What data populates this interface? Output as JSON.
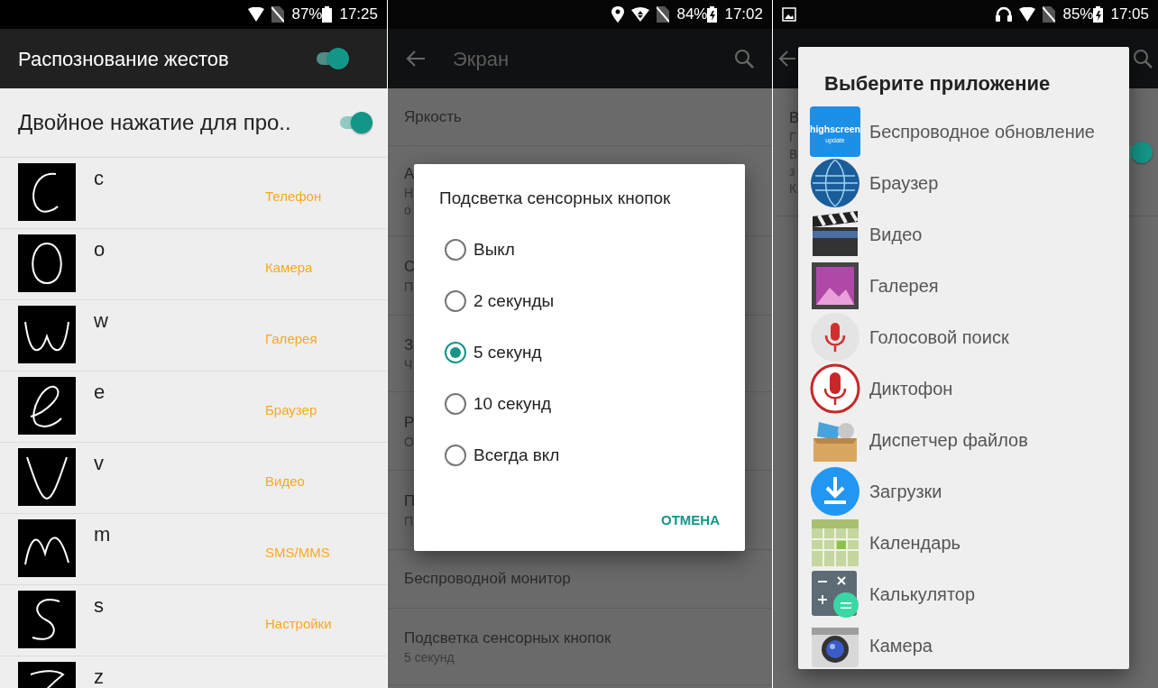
{
  "gesture_screen": {
    "status": {
      "battery": "87%",
      "charging": false,
      "time": "17:25"
    },
    "app_bar": {
      "title": "Распознование жестов",
      "on": true
    },
    "master": {
      "label": "Двойное нажатие для про..",
      "on": true
    },
    "gestures": [
      {
        "letter": "c",
        "app": "Телефон"
      },
      {
        "letter": "o",
        "app": "Камера"
      },
      {
        "letter": "w",
        "app": "Галерея"
      },
      {
        "letter": "e",
        "app": "Браузер"
      },
      {
        "letter": "v",
        "app": "Видео"
      },
      {
        "letter": "m",
        "app": "SMS/MMS"
      },
      {
        "letter": "s",
        "app": "Настройки"
      },
      {
        "letter": "z"
      }
    ]
  },
  "display_screen": {
    "status": {
      "battery": "84%",
      "charging": true,
      "time": "17:02"
    },
    "app_bar": {
      "title": "Экран"
    },
    "settings": [
      {
        "title": "Яркость"
      },
      {
        "title": "А",
        "summary_lines": [
          "Н",
          "о"
        ]
      },
      {
        "title": "С",
        "summary_lines": [
          "П"
        ]
      },
      {
        "title": "З",
        "summary_lines": [
          "Ч"
        ]
      },
      {
        "title": "Р",
        "summary_lines": [
          "О"
        ]
      },
      {
        "title": "П",
        "summary_lines": [
          "П"
        ]
      },
      {
        "title": "Беспроводной монитор"
      },
      {
        "title": "Подсветка сенсорных кнопок",
        "summary_lines": [
          "5 секунд"
        ]
      }
    ],
    "dialog": {
      "title": "Подсветка сенсорных кнопок",
      "options": [
        {
          "label": "Выкл",
          "selected": false
        },
        {
          "label": "2 секунды",
          "selected": false
        },
        {
          "label": "5 секунд",
          "selected": true
        },
        {
          "label": "10 секунд",
          "selected": false
        },
        {
          "label": "Всегда вкл",
          "selected": false
        }
      ],
      "button": "ОТМЕНА"
    }
  },
  "chooser_screen": {
    "status": {
      "battery": "85%",
      "charging": true,
      "time": "17:05"
    },
    "background_row": {
      "title": "В",
      "summary_lines": [
        "Г",
        "В",
        "з",
        "К"
      ],
      "on": true
    },
    "dialog": {
      "title": "Выберите приложение",
      "apps": [
        {
          "label": "Беспроводное обновление",
          "icon_text": [
            "highscreen",
            "update"
          ]
        },
        {
          "label": "Браузер"
        },
        {
          "label": "Видео"
        },
        {
          "label": "Галерея"
        },
        {
          "label": "Голосовой поиск"
        },
        {
          "label": "Диктофон"
        },
        {
          "label": "Диспетчер файлов"
        },
        {
          "label": "Загрузки"
        },
        {
          "label": "Календарь"
        },
        {
          "label": "Калькулятор"
        },
        {
          "label": "Камера"
        }
      ]
    }
  }
}
